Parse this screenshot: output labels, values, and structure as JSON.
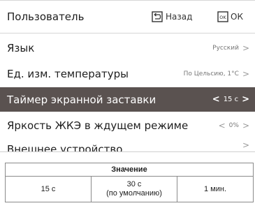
{
  "header": {
    "title": "Пользователь",
    "back_label": "Назад",
    "ok_label": "ОК",
    "ok_icon_text": "OK"
  },
  "menu": {
    "items": [
      {
        "label": "Язык",
        "value": "Русский"
      },
      {
        "label": "Ед. изм. температуры",
        "value": "По Цельсию, 1°C"
      },
      {
        "label": "Таймер экранной заставки",
        "value": "15 с",
        "selected": true
      },
      {
        "label": "Яркость ЖКЭ в ждущем режиме",
        "value": "0%"
      },
      {
        "label": "Внешнее устройство",
        "value": ""
      }
    ]
  },
  "table": {
    "header": "Значение",
    "cells": [
      {
        "line1": "15 с"
      },
      {
        "line1": "30 с",
        "line2": "(по умолчанию)"
      },
      {
        "line1": "1 мин."
      }
    ]
  },
  "colors": {
    "selected_row_bg": "#5a5250",
    "selected_row_text": "#ffffff"
  }
}
